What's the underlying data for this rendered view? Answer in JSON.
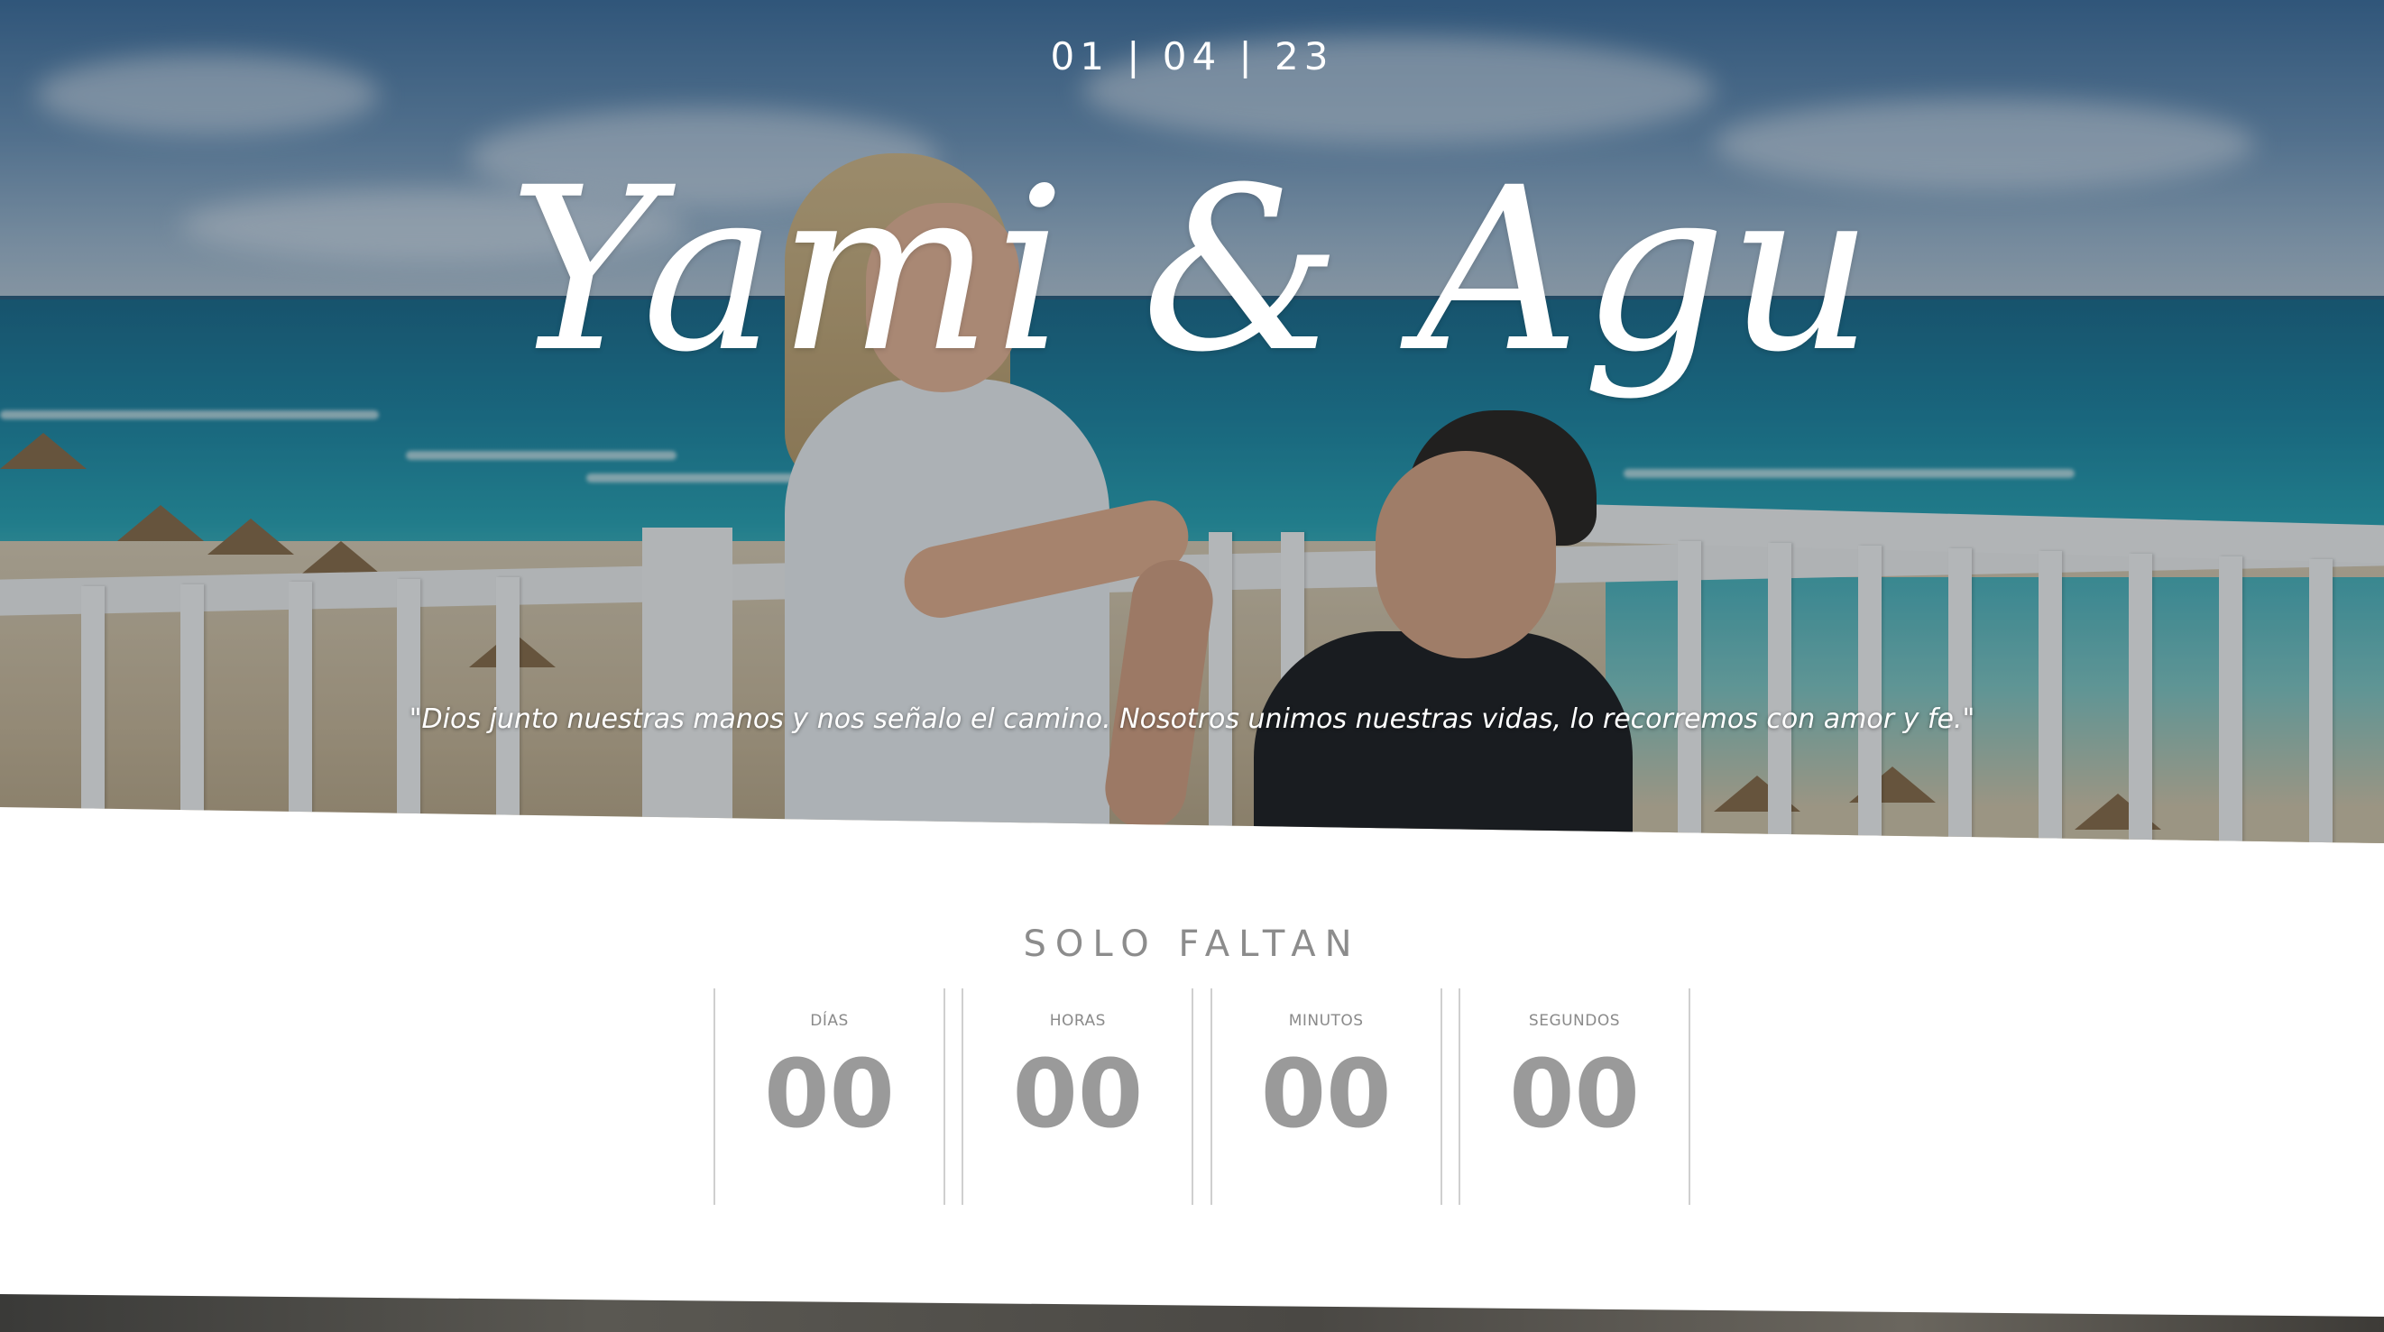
{
  "hero": {
    "date": "01 | 04 | 23",
    "names": "Yami & Agu",
    "quote": "\"Dios junto nuestras manos y nos señalo el camino. Nosotros unimos nuestras vidas, lo recorremos con amor y fe.\""
  },
  "countdown": {
    "title": "SOLO FALTAN",
    "units": [
      {
        "label": "DÍAS",
        "value": "00"
      },
      {
        "label": "HORAS",
        "value": "00"
      },
      {
        "label": "MINUTOS",
        "value": "00"
      },
      {
        "label": "SEGUNDOS",
        "value": "00"
      }
    ]
  },
  "colors": {
    "heading_gray": "#8c8c8c",
    "number_gray": "#9a9a9a",
    "divider": "#cfcfcf",
    "hero_text": "#ffffff"
  }
}
